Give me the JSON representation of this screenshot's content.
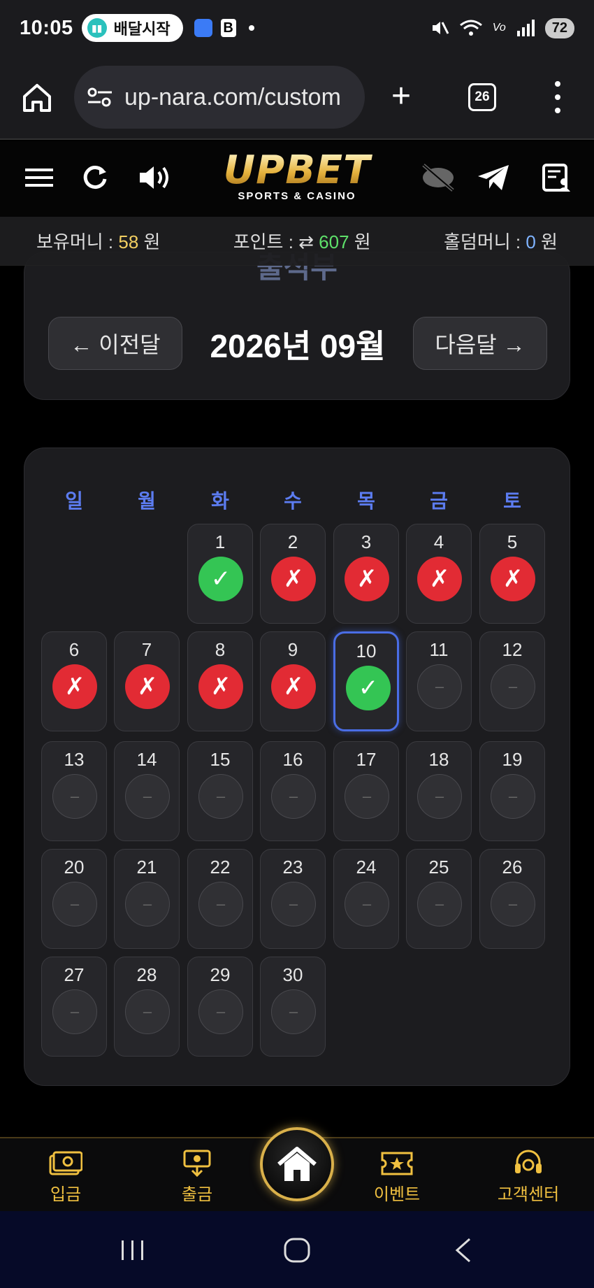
{
  "status_bar": {
    "time": "10:05",
    "notification_pill": "배달시작",
    "app_badge": "B",
    "battery": "72"
  },
  "browser": {
    "url": "up-nara.com/custom",
    "tab_count": "26"
  },
  "site": {
    "logo_text": "UPBET",
    "logo_sub": "SPORTS & CASINO"
  },
  "balance": {
    "money_label": "보유머니 : ",
    "money_value": "58",
    "money_unit": " 원",
    "point_label": "포인트 : ",
    "point_value": "607",
    "point_unit": " 원",
    "holdem_label": "홀덤머니 : ",
    "holdem_value": "0",
    "holdem_unit": " 원"
  },
  "attendance": {
    "title": "출석부",
    "prev_label": "← 이전달",
    "next_label": "다음달 →",
    "month_label": "2026년 09월"
  },
  "calendar": {
    "weekdays": [
      "일",
      "월",
      "화",
      "수",
      "목",
      "금",
      "토"
    ],
    "days": [
      {
        "n": "1",
        "s": "ok"
      },
      {
        "n": "2",
        "s": "x"
      },
      {
        "n": "3",
        "s": "x"
      },
      {
        "n": "4",
        "s": "x"
      },
      {
        "n": "5",
        "s": "x"
      },
      {
        "n": "6",
        "s": "x"
      },
      {
        "n": "7",
        "s": "x"
      },
      {
        "n": "8",
        "s": "x"
      },
      {
        "n": "9",
        "s": "x"
      },
      {
        "n": "10",
        "s": "ok",
        "today": true
      },
      {
        "n": "11",
        "s": "none"
      },
      {
        "n": "12",
        "s": "none"
      },
      {
        "n": "13",
        "s": "none"
      },
      {
        "n": "14",
        "s": "none"
      },
      {
        "n": "15",
        "s": "none"
      },
      {
        "n": "16",
        "s": "none"
      },
      {
        "n": "17",
        "s": "none"
      },
      {
        "n": "18",
        "s": "none"
      },
      {
        "n": "19",
        "s": "none"
      },
      {
        "n": "20",
        "s": "none"
      },
      {
        "n": "21",
        "s": "none"
      },
      {
        "n": "22",
        "s": "none"
      },
      {
        "n": "23",
        "s": "none"
      },
      {
        "n": "24",
        "s": "none"
      },
      {
        "n": "25",
        "s": "none"
      },
      {
        "n": "26",
        "s": "none"
      },
      {
        "n": "27",
        "s": "none"
      },
      {
        "n": "28",
        "s": "none"
      },
      {
        "n": "29",
        "s": "none"
      },
      {
        "n": "30",
        "s": "none"
      }
    ],
    "first_weekday_index": 2,
    "mark_symbols": {
      "ok": "✓",
      "x": "✗",
      "none": "–"
    }
  },
  "bottom_nav": {
    "deposit": "입금",
    "withdraw": "출금",
    "event": "이벤트",
    "support": "고객센터"
  },
  "colors": {
    "accent_gold": "#f0c040",
    "check_green": "#34c554",
    "miss_red": "#e22b34",
    "weekday_blue": "#5c7cf0",
    "today_border": "#4a6de5"
  }
}
